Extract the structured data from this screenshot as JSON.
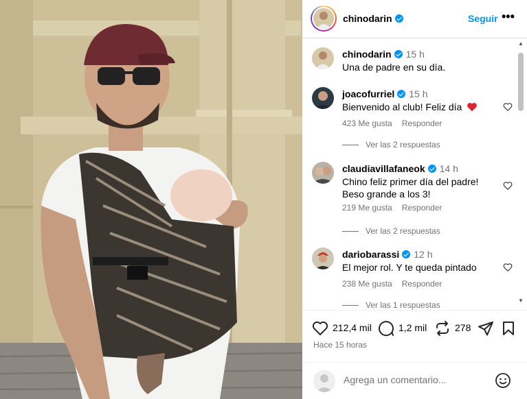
{
  "post": {
    "author": "chinodarin",
    "follow_label": "Seguir",
    "more_label": "•••"
  },
  "comments": [
    {
      "user": "chinodarin",
      "time": "15 h",
      "text": "Una de padre en su día.",
      "is_caption": true
    },
    {
      "user": "joacofurriel",
      "time": "15 h",
      "text": "Bienvenido al club! Feliz día",
      "likes": "423 Me gusta",
      "reply": "Responder",
      "view_replies": "Ver las 2 respuestas"
    },
    {
      "user": "claudiavillafaneok",
      "time": "14 h",
      "text": "Chino feliz primer día del padre! Beso grande a los 3!",
      "likes": "219 Me gusta",
      "reply": "Responder",
      "view_replies": "Ver las 2 respuestas"
    },
    {
      "user": "dariobarassi",
      "time": "12 h",
      "text": "El mejor rol. Y te queda pintado",
      "likes": "238 Me gusta",
      "reply": "Responder",
      "view_replies": "Ver las 1 respuestas"
    }
  ],
  "actions": {
    "likes": "212,4 mil",
    "comments": "1,2 mil",
    "reposts": "278",
    "posted": "Hace 15 horas"
  },
  "add_comment": {
    "placeholder": "Agrega un comentario..."
  },
  "colors": {
    "accent": "#0095f6",
    "heart_red": "#ed4956",
    "muted": "#737373"
  }
}
